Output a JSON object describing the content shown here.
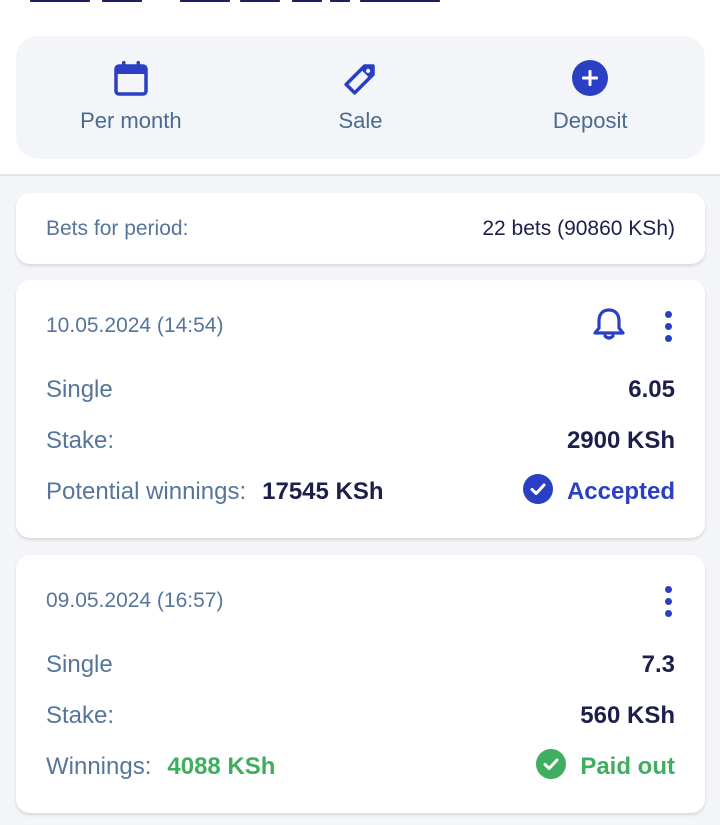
{
  "colors": {
    "accent": "#2b3fc4",
    "success": "#3fae5f",
    "label": "#55769a",
    "value": "#1b1f4a",
    "background": "#f3f5f9"
  },
  "quick_actions": [
    {
      "label": "Per month",
      "icon": "calendar-icon"
    },
    {
      "label": "Sale",
      "icon": "tag-icon"
    },
    {
      "label": "Deposit",
      "icon": "plus-circle-icon"
    }
  ],
  "summary": {
    "label": "Bets for period:",
    "value": "22 bets (90860 KSh)"
  },
  "bets": [
    {
      "datetime": "10.05.2024 (14:54)",
      "type": "Single",
      "odds": "6.05",
      "stake_label": "Stake:",
      "stake": "2900 KSh",
      "winnings_label": "Potential winnings:",
      "winnings": "17545 KSh",
      "status": "Accepted",
      "has_bell": true
    },
    {
      "datetime": "09.05.2024 (16:57)",
      "type": "Single",
      "odds": "7.3",
      "stake_label": "Stake:",
      "stake": "560 KSh",
      "winnings_label": "Winnings:",
      "winnings": "4088 KSh",
      "status": "Paid out",
      "has_bell": false
    }
  ]
}
